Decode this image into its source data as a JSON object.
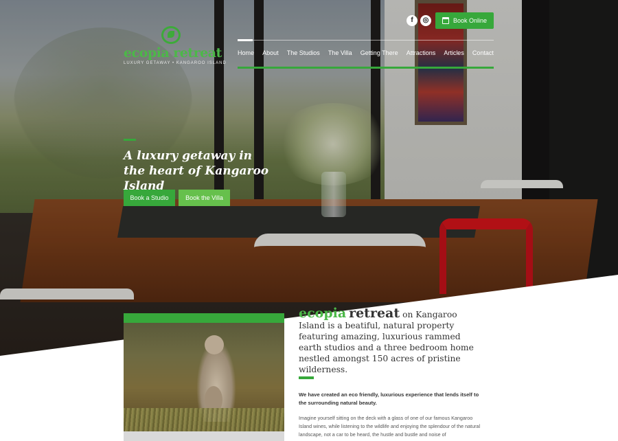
{
  "brand": {
    "name": "ecopia retreat",
    "tagline": "LUXURY GETAWAY • KANGAROO ISLAND"
  },
  "header": {
    "social": [
      {
        "name": "facebook-icon",
        "glyph": "f"
      },
      {
        "name": "instagram-icon",
        "glyph": "◎"
      }
    ],
    "book_online": "Book Online"
  },
  "nav": {
    "items": [
      {
        "label": "Home"
      },
      {
        "label": "About"
      },
      {
        "label": "The Studios"
      },
      {
        "label": "The Villa"
      },
      {
        "label": "Getting There"
      },
      {
        "label": "Attractions"
      },
      {
        "label": "Articles"
      },
      {
        "label": "Contact"
      }
    ]
  },
  "hero": {
    "title": "A luxury getaway in the heart of Kangaroo Island",
    "btn_studio": "Book a Studio",
    "btn_villa": "Book the Villa"
  },
  "content": {
    "headline_brand1": "ecopia",
    "headline_brand2": "retreat",
    "headline_rest": "on Kangaroo Island is a beatiful, natural property featuring amazing, luxurious rammed earth studios and a three bedroom home nestled amongst 150 acres of pristine wilderness.",
    "intro_bold": "We have created an eco friendly, luxurious experience that lends itself to the surrounding natural beauty.",
    "intro_body": "Imagine yourself sitting on the deck with a glass of one of our famous Kangaroo Island wines, while listening to the wildlife and enjoying the splendour of the natural landscape, not a car to be heard, the hustle and bustle and noise of"
  },
  "colors": {
    "accent": "#37a83b",
    "brand_green": "#4cb848",
    "accent_light": "#66c04c"
  }
}
